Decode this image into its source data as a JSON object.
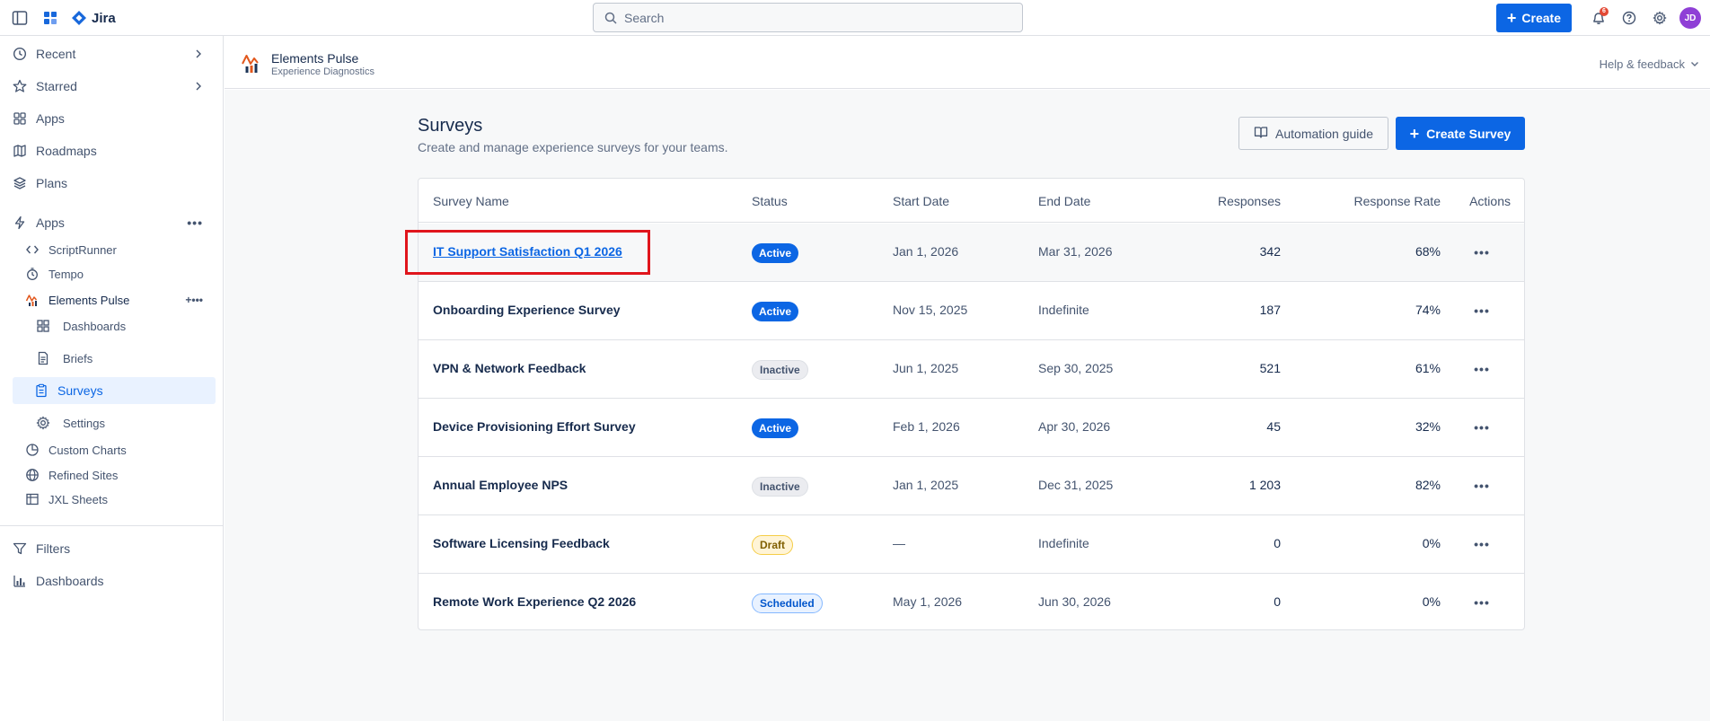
{
  "topbar": {
    "brand": "Jira",
    "search_placeholder": "Search",
    "create_label": "Create",
    "notification_count": "6",
    "avatar_initials": "JD"
  },
  "sidebar": {
    "recent": "Recent",
    "starred": "Starred",
    "apps_top": "Apps",
    "roadmaps": "Roadmaps",
    "plans": "Plans",
    "apps_section": "Apps",
    "scriptrunner": "ScriptRunner",
    "tempo": "Tempo",
    "elements_pulse": "Elements Pulse",
    "dashboards_sub": "Dashboards",
    "briefs": "Briefs",
    "surveys": "Surveys",
    "settings": "Settings",
    "custom_charts": "Custom Charts",
    "refined_sites": "Refined Sites",
    "jxl_sheets": "JXL Sheets",
    "filters": "Filters",
    "dashboards": "Dashboards"
  },
  "app_header": {
    "title": "Elements Pulse",
    "subtitle": "Experience Diagnostics",
    "help": "Help & feedback"
  },
  "page": {
    "title": "Surveys",
    "description": "Create and manage experience surveys for your teams.",
    "guide_button": "Automation guide",
    "create_button": "Create Survey"
  },
  "table": {
    "headers": {
      "name": "Survey Name",
      "status": "Status",
      "start": "Start Date",
      "end": "End Date",
      "responses": "Responses",
      "rate": "Response Rate",
      "actions": "Actions"
    },
    "rows": [
      {
        "name": "IT Support Satisfaction Q1 2026",
        "status": "Active",
        "start": "Jan 1, 2026",
        "end": "Mar 31, 2026",
        "responses": "342",
        "rate": "68%"
      },
      {
        "name": "Onboarding Experience Survey",
        "status": "Active",
        "start": "Nov 15, 2025",
        "end": "Indefinite",
        "responses": "187",
        "rate": "74%"
      },
      {
        "name": "VPN & Network Feedback",
        "status": "Inactive",
        "start": "Jun 1, 2025",
        "end": "Sep 30, 2025",
        "responses": "521",
        "rate": "61%"
      },
      {
        "name": "Device Provisioning Effort Survey",
        "status": "Active",
        "start": "Feb 1, 2026",
        "end": "Apr 30, 2026",
        "responses": "45",
        "rate": "32%"
      },
      {
        "name": "Annual Employee NPS",
        "status": "Inactive",
        "start": "Jan 1, 2025",
        "end": "Dec 31, 2025",
        "responses": "1 203",
        "rate": "82%"
      },
      {
        "name": "Software Licensing Feedback",
        "status": "Draft",
        "start": "—",
        "end": "Indefinite",
        "responses": "0",
        "rate": "0%"
      },
      {
        "name": "Remote Work Experience Q2 2026",
        "status": "Scheduled",
        "start": "May 1, 2026",
        "end": "Jun 30, 2026",
        "responses": "0",
        "rate": "0%"
      }
    ]
  }
}
